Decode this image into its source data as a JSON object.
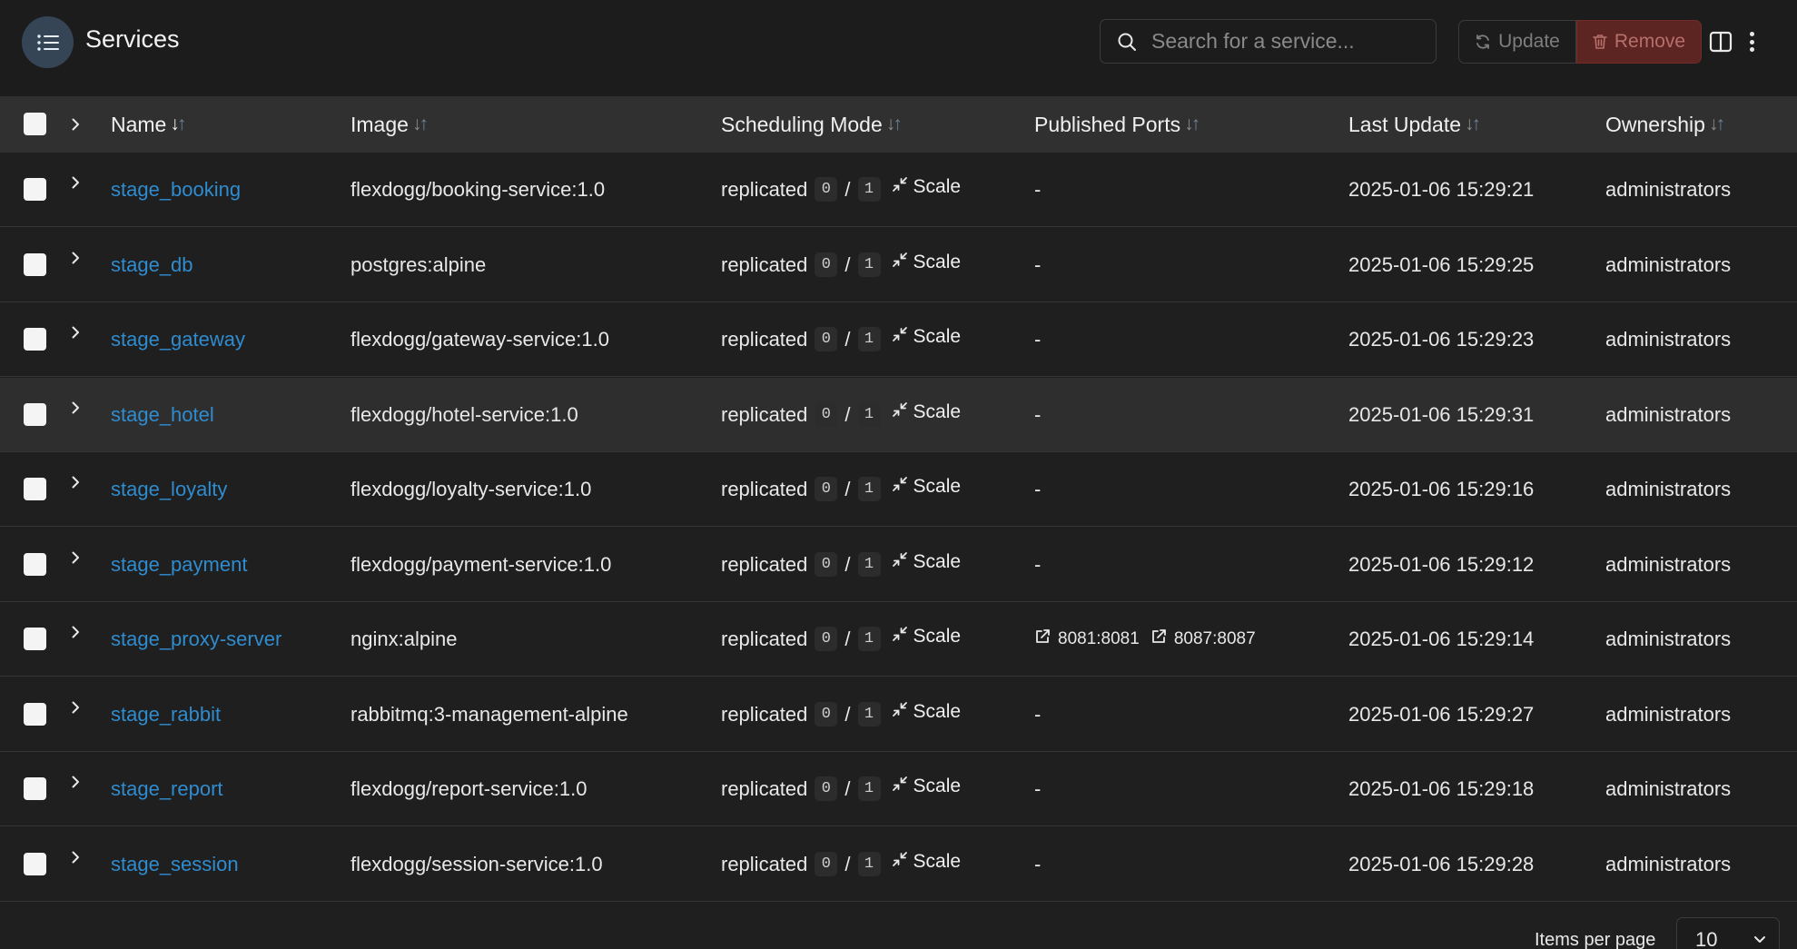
{
  "header": {
    "title": "Services",
    "search_placeholder": "Search for a service...",
    "update_label": "Update",
    "remove_label": "Remove"
  },
  "table": {
    "columns": [
      "Name",
      "Image",
      "Scheduling Mode",
      "Published Ports",
      "Last Update",
      "Ownership"
    ],
    "rows": [
      {
        "name": "stage_booking",
        "image": "flexdogg/booking-service:1.0",
        "mode": "replicated",
        "running": "0",
        "desired": "1",
        "scale": "Scale",
        "ports": "-",
        "updated": "2025-01-06 15:29:21",
        "ownership": "administrators"
      },
      {
        "name": "stage_db",
        "image": "postgres:alpine",
        "mode": "replicated",
        "running": "0",
        "desired": "1",
        "scale": "Scale",
        "ports": "-",
        "updated": "2025-01-06 15:29:25",
        "ownership": "administrators"
      },
      {
        "name": "stage_gateway",
        "image": "flexdogg/gateway-service:1.0",
        "mode": "replicated",
        "running": "0",
        "desired": "1",
        "scale": "Scale",
        "ports": "-",
        "updated": "2025-01-06 15:29:23",
        "ownership": "administrators"
      },
      {
        "name": "stage_hotel",
        "image": "flexdogg/hotel-service:1.0",
        "mode": "replicated",
        "running": "0",
        "desired": "1",
        "scale": "Scale",
        "ports": "-",
        "updated": "2025-01-06 15:29:31",
        "ownership": "administrators"
      },
      {
        "name": "stage_loyalty",
        "image": "flexdogg/loyalty-service:1.0",
        "mode": "replicated",
        "running": "0",
        "desired": "1",
        "scale": "Scale",
        "ports": "-",
        "updated": "2025-01-06 15:29:16",
        "ownership": "administrators"
      },
      {
        "name": "stage_payment",
        "image": "flexdogg/payment-service:1.0",
        "mode": "replicated",
        "running": "0",
        "desired": "1",
        "scale": "Scale",
        "ports": "-",
        "updated": "2025-01-06 15:29:12",
        "ownership": "administrators"
      },
      {
        "name": "stage_proxy-server",
        "image": "nginx:alpine",
        "mode": "replicated",
        "running": "0",
        "desired": "1",
        "scale": "Scale",
        "ports": "",
        "port_links": [
          "8081:8081",
          "8087:8087"
        ],
        "updated": "2025-01-06 15:29:14",
        "ownership": "administrators"
      },
      {
        "name": "stage_rabbit",
        "image": "rabbitmq:3-management-alpine",
        "mode": "replicated",
        "running": "0",
        "desired": "1",
        "scale": "Scale",
        "ports": "-",
        "updated": "2025-01-06 15:29:27",
        "ownership": "administrators"
      },
      {
        "name": "stage_report",
        "image": "flexdogg/report-service:1.0",
        "mode": "replicated",
        "running": "0",
        "desired": "1",
        "scale": "Scale",
        "ports": "-",
        "updated": "2025-01-06 15:29:18",
        "ownership": "administrators"
      },
      {
        "name": "stage_session",
        "image": "flexdogg/session-service:1.0",
        "mode": "replicated",
        "running": "0",
        "desired": "1",
        "scale": "Scale",
        "ports": "-",
        "updated": "2025-01-06 15:29:28",
        "ownership": "administrators"
      }
    ]
  },
  "footer": {
    "items_per_page_label": "Items per page",
    "items_per_page_value": "10"
  },
  "icons": {
    "title": "list-icon",
    "search": "search-icon",
    "update": "refresh-icon",
    "remove": "trash-icon",
    "columns": "columns-icon",
    "more": "more-vertical-icon",
    "scale": "minimize-icon",
    "port": "external-link-icon",
    "expand": "chevron-right-icon"
  },
  "colors": {
    "link": "#2f8ccf",
    "remove_bg": "#5c2522",
    "title_icon_bg": "#364556"
  }
}
